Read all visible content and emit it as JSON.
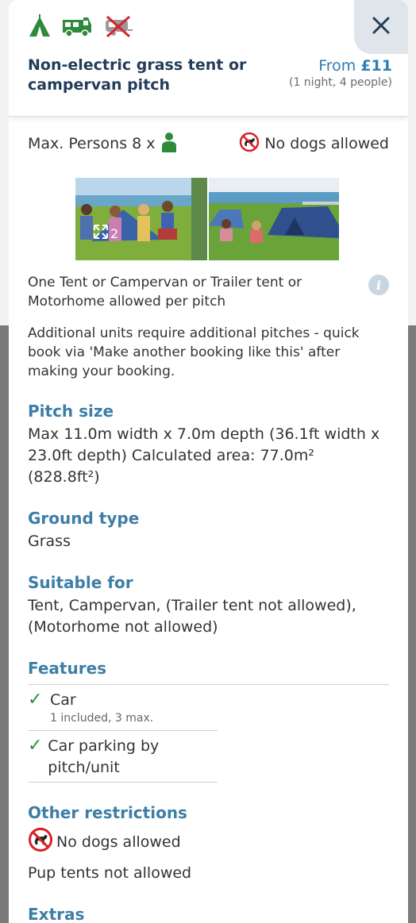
{
  "header": {
    "pitch_title": "Non-electric grass tent or campervan pitch",
    "price_prefix": "From",
    "price_value": "£11",
    "price_detail": "(1 night, 4 people)",
    "type_icons": [
      "tent-icon",
      "campervan-icon",
      "caravan-not-allowed-icon"
    ],
    "close_label": "×"
  },
  "summary": {
    "max_persons": "Max. Persons 8 x",
    "dogs": "No dogs allowed"
  },
  "gallery": {
    "photo_count": "2"
  },
  "description": {
    "units_allowed": "One Tent or Campervan or Trailer tent or Motorhome allowed per pitch",
    "additional_units": "Additional units require additional pitches - quick book via 'Make another booking like this' after making your booking."
  },
  "pitch_size": {
    "title": "Pitch size",
    "text": "Max 11.0m width x 7.0m depth (36.1ft width x 23.0ft depth) Calculated area: 77.0m² (828.8ft²)"
  },
  "ground_type": {
    "title": "Ground type",
    "text": "Grass"
  },
  "suitable_for": {
    "title": "Suitable for",
    "text": "Tent, Campervan, (Trailer tent not allowed), (Motorhome not allowed)"
  },
  "features": {
    "title": "Features",
    "items": [
      {
        "label": "Car",
        "note": "1 included, 3 max."
      },
      {
        "label": "Car parking by pitch/unit",
        "note": ""
      }
    ]
  },
  "other_restrictions": {
    "title": "Other restrictions",
    "dogs": "No dogs allowed",
    "pup_tents": "Pup tents not allowed"
  },
  "extras": {
    "title": "Extras"
  },
  "colors": {
    "accent": "#3d7ea6",
    "green": "#2e8b3a",
    "title": "#233d58",
    "price": "#2f7db6"
  }
}
